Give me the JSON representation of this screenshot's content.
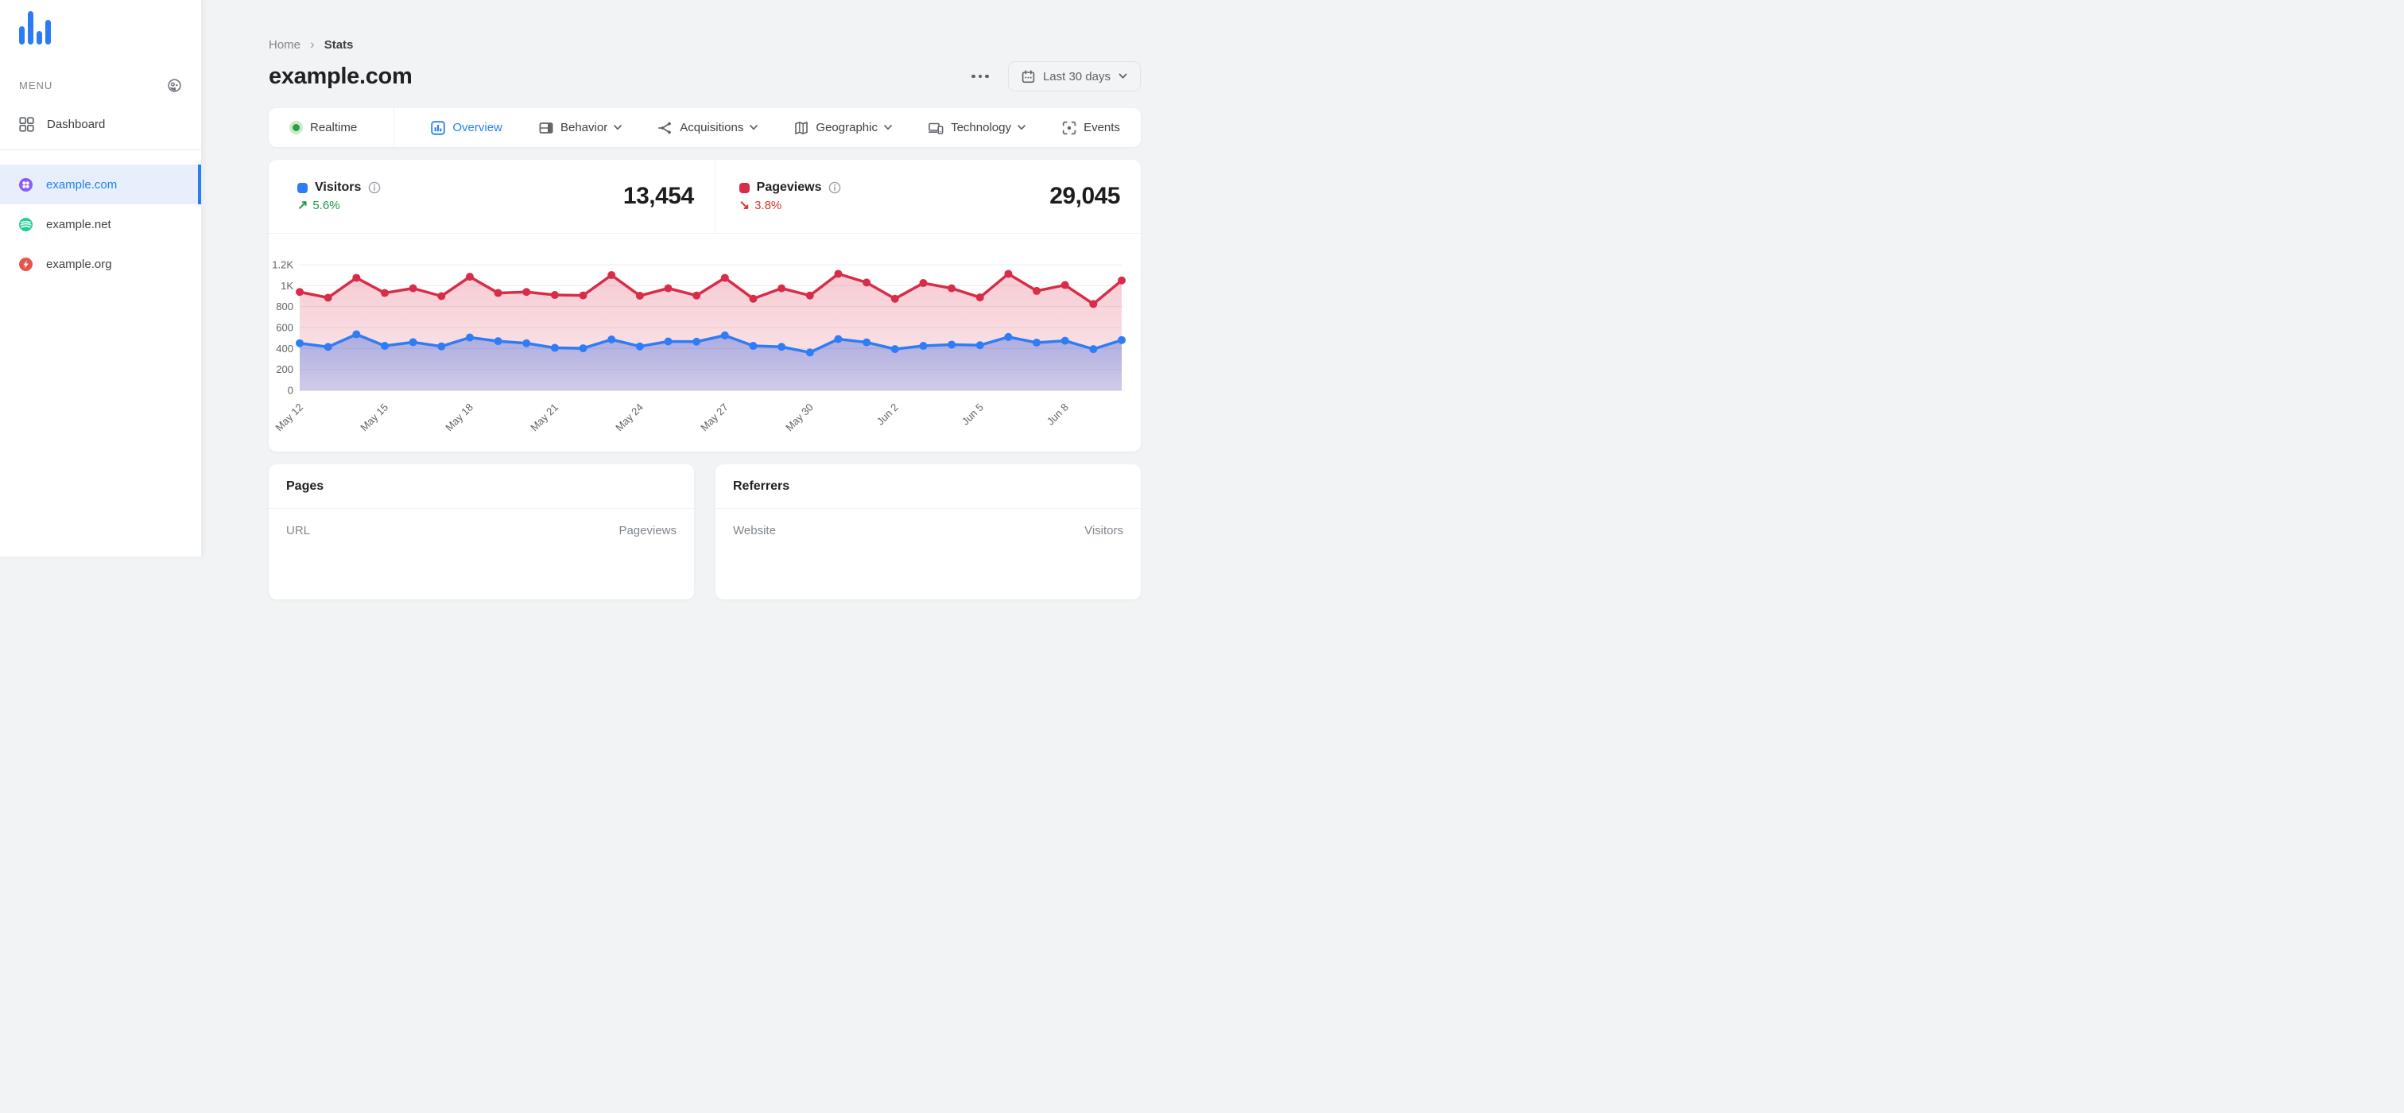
{
  "sidebar": {
    "menu_label": "MENU",
    "dashboard_label": "Dashboard",
    "sites": [
      {
        "name": "example.com",
        "selected": true,
        "icon": "clover",
        "color": "#8a5cf6"
      },
      {
        "name": "example.net",
        "selected": false,
        "icon": "waves",
        "color": "#1fce93"
      },
      {
        "name": "example.org",
        "selected": false,
        "icon": "bolt",
        "color": "#e8544d"
      }
    ]
  },
  "header": {
    "breadcrumb": [
      "Home",
      "Stats"
    ],
    "title": "example.com",
    "date_range": "Last 30 days"
  },
  "tabs": [
    {
      "label": "Realtime",
      "icon": "live-dot",
      "active": false,
      "dropdown": false
    },
    {
      "label": "Overview",
      "icon": "bar-chart",
      "active": true,
      "dropdown": false
    },
    {
      "label": "Behavior",
      "icon": "layout",
      "active": false,
      "dropdown": true
    },
    {
      "label": "Acquisitions",
      "icon": "share",
      "active": false,
      "dropdown": true
    },
    {
      "label": "Geographic",
      "icon": "map",
      "active": false,
      "dropdown": true
    },
    {
      "label": "Technology",
      "icon": "devices",
      "active": false,
      "dropdown": true
    },
    {
      "label": "Events",
      "icon": "scan",
      "active": false,
      "dropdown": false
    }
  ],
  "stats": [
    {
      "label": "Visitors",
      "value": "13,454",
      "change": "5.6%",
      "direction": "up",
      "arrow": "↗",
      "color": "#2e7cf6"
    },
    {
      "label": "Pageviews",
      "value": "29,045",
      "change": "3.8%",
      "direction": "down",
      "arrow": "↘",
      "color": "#d92c48"
    }
  ],
  "chart_data": {
    "type": "line",
    "area": true,
    "grid": true,
    "legend": "none",
    "ylim": [
      0,
      1200
    ],
    "yticks": [
      {
        "v": 0,
        "label": "0"
      },
      {
        "v": 200,
        "label": "200"
      },
      {
        "v": 400,
        "label": "400"
      },
      {
        "v": 600,
        "label": "600"
      },
      {
        "v": 800,
        "label": "800"
      },
      {
        "v": 1000,
        "label": "1K"
      },
      {
        "v": 1200,
        "label": "1.2K"
      }
    ],
    "x": [
      "May 12",
      "May 13",
      "May 14",
      "May 15",
      "May 16",
      "May 17",
      "May 18",
      "May 19",
      "May 20",
      "May 21",
      "May 22",
      "May 23",
      "May 24",
      "May 25",
      "May 26",
      "May 27",
      "May 28",
      "May 29",
      "May 30",
      "May 31",
      "Jun 1",
      "Jun 2",
      "Jun 3",
      "Jun 4",
      "Jun 5",
      "Jun 6",
      "Jun 7",
      "Jun 8",
      "Jun 9",
      "Jun 10"
    ],
    "x_tick_indices": [
      0,
      3,
      6,
      9,
      12,
      15,
      18,
      21,
      24,
      27
    ],
    "series": [
      {
        "name": "Pageviews",
        "color": "#d92c48",
        "total": 29045,
        "values": [
          940,
          885,
          1075,
          930,
          975,
          900,
          1085,
          930,
          940,
          911,
          907,
          1101,
          904,
          975,
          906,
          1075,
          875,
          975,
          906,
          1113,
          1030,
          875,
          1025,
          975,
          888,
          1113,
          950,
          1006,
          825,
          1050
        ]
      },
      {
        "name": "Visitors",
        "color": "#2e7cf6",
        "total": 13454,
        "values": [
          450,
          415,
          535,
          425,
          460,
          420,
          505,
          470,
          450,
          406,
          402,
          486,
          420,
          467,
          465,
          525,
          425,
          416,
          362,
          490,
          459,
          394,
          425,
          437,
          431,
          510,
          456,
          474,
          394,
          480
        ]
      }
    ]
  },
  "tables": {
    "pages": {
      "title": "Pages",
      "columns": [
        "URL",
        "Pageviews"
      ]
    },
    "referrers": {
      "title": "Referrers",
      "columns": [
        "Website",
        "Visitors"
      ]
    }
  },
  "colors": {
    "accent": "#2680eb",
    "visitors": "#2e7cf6",
    "pageviews": "#d92c48",
    "positive": "#1a9c42",
    "negative": "#d93025",
    "background": "#f1f3f4"
  }
}
